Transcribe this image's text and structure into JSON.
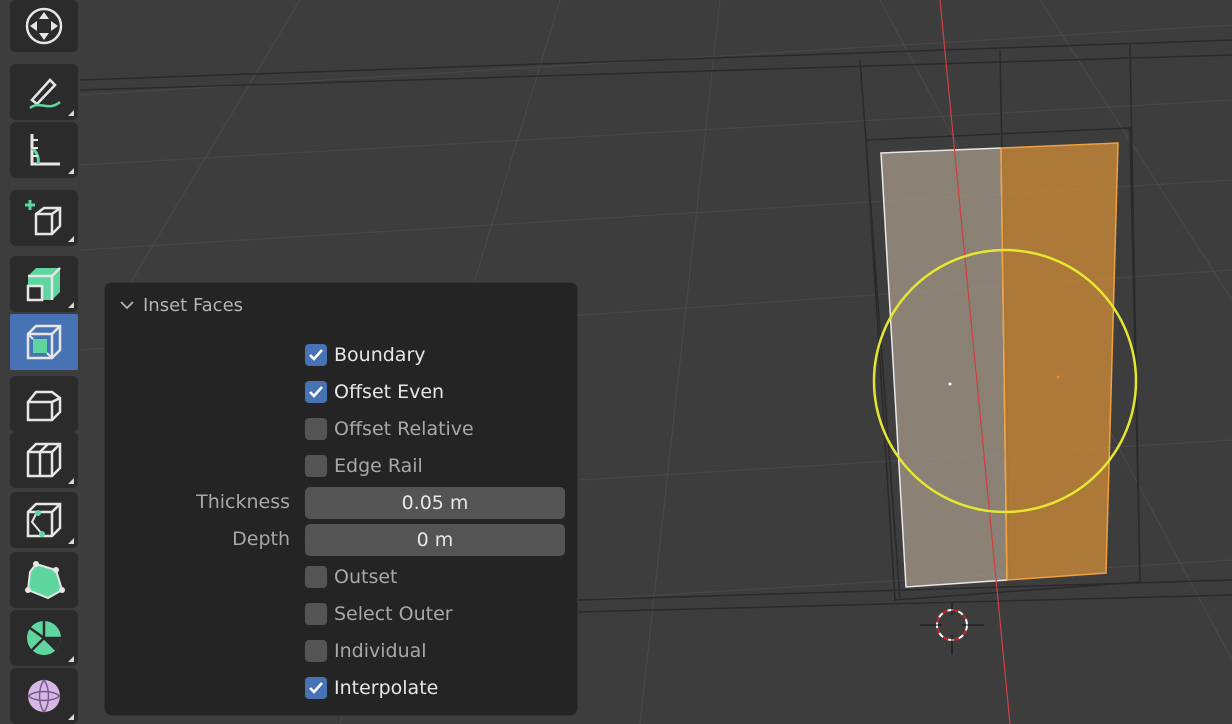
{
  "viewport": {
    "name": "3d-viewport"
  },
  "toolbar": {
    "tools": [
      {
        "icon": "transform-navigate-icon",
        "active": false
      },
      {
        "icon": "annotate-icon",
        "active": false
      },
      {
        "icon": "measure-icon",
        "active": false
      },
      {
        "icon": "add-cube-icon",
        "active": false
      },
      {
        "icon": "extrude-region-icon",
        "active": false
      },
      {
        "icon": "inset-faces-icon",
        "active": true
      },
      {
        "icon": "bevel-icon",
        "active": false
      },
      {
        "icon": "loop-cut-icon",
        "active": false
      },
      {
        "icon": "knife-icon",
        "active": false
      },
      {
        "icon": "poly-build-icon",
        "active": false
      },
      {
        "icon": "spin-icon",
        "active": false
      },
      {
        "icon": "smooth-icon",
        "active": false
      }
    ]
  },
  "panel": {
    "title": "Inset Faces",
    "boundary": {
      "label": "Boundary",
      "checked": true
    },
    "offset_even": {
      "label": "Offset Even",
      "checked": true
    },
    "offset_relative": {
      "label": "Offset Relative",
      "checked": false
    },
    "edge_rail": {
      "label": "Edge Rail",
      "checked": false
    },
    "thickness": {
      "label": "Thickness",
      "value": "0.05 m"
    },
    "depth": {
      "label": "Depth",
      "value": "0 m"
    },
    "outset": {
      "label": "Outset",
      "checked": false
    },
    "select_outer": {
      "label": "Select Outer",
      "checked": false
    },
    "individual": {
      "label": "Individual",
      "checked": false
    },
    "interpolate": {
      "label": "Interpolate",
      "checked": true
    }
  },
  "colors": {
    "active_tool": "#4772b3",
    "selection_orange": "#f0a040",
    "proportional_circle": "#e6e632",
    "x_axis_red": "#d04040"
  }
}
